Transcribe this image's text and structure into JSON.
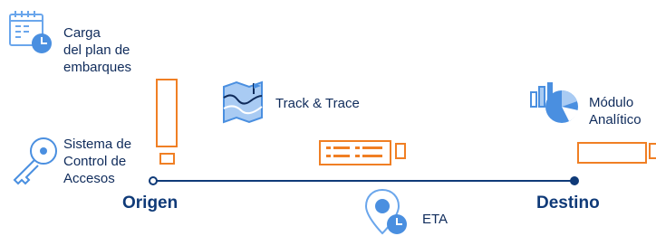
{
  "features": {
    "carga_label": "Carga\ndel plan de\nembarques",
    "track_label": "Track & Trace",
    "modulo_label": "Módulo\nAnalítico",
    "acceso_label": "Sistema de\nControl de\nAccesos",
    "eta_label": "ETA"
  },
  "timeline": {
    "origin_label": "Origen",
    "destination_label": "Destino"
  },
  "colors": {
    "navy": "#0f2b5b",
    "line": "#0f3a78",
    "icon_blue": "#4a8fe0",
    "light_blue": "#a9cbf3",
    "orange": "#f07f24"
  }
}
